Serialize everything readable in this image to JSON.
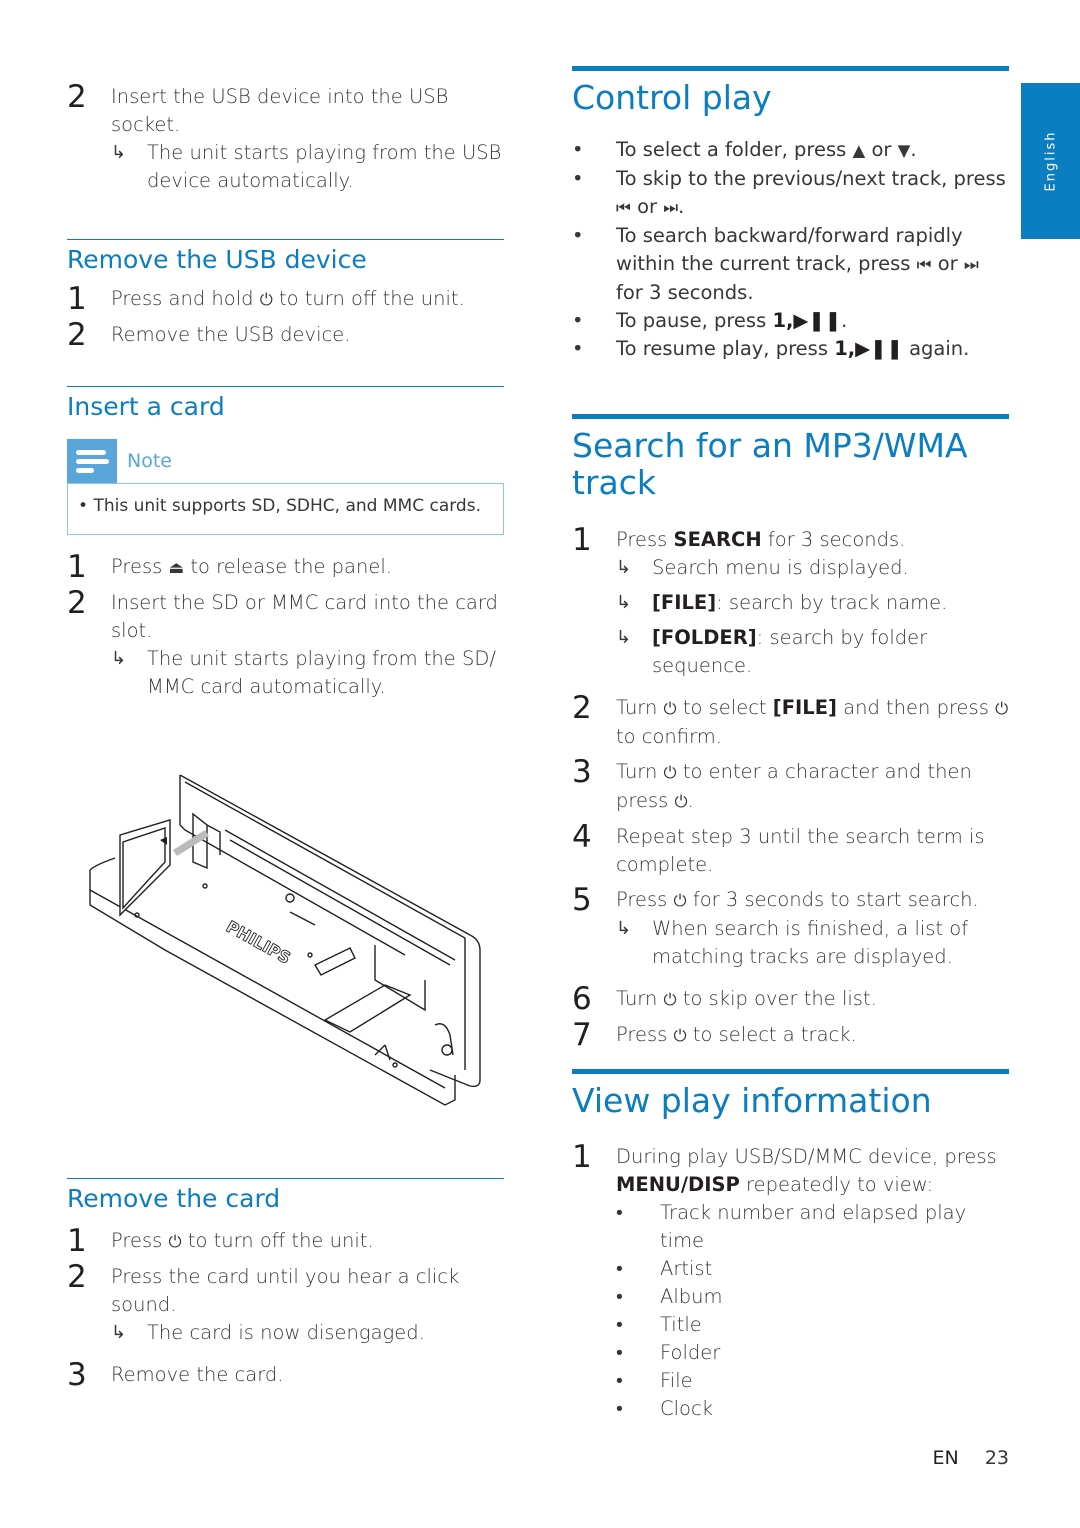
{
  "side_tab": {
    "label": "English",
    "color": "#0b7dc1"
  },
  "accent_color": "#0b7dc1",
  "left": {
    "insert_usb": {
      "step2_num": "2",
      "step2_text": "Insert the USB device into the USB socket.",
      "step2_result": "The unit starts playing from the USB device automatically."
    },
    "remove_usb": {
      "title": "Remove the USB device",
      "steps": [
        {
          "num": "1",
          "pre": "Press and hold",
          "icon": "power-icon",
          "post": "to turn off the unit."
        },
        {
          "num": "2",
          "text": "Remove the USB device."
        }
      ]
    },
    "insert_card": {
      "title": "Insert a card",
      "note_label": "Note",
      "note_text": "This unit supports SD, SDHC, and MMC cards.",
      "steps": [
        {
          "num": "1",
          "pre": "Press",
          "icon": "eject-icon",
          "post": "to release the panel."
        },
        {
          "num": "2",
          "text": "Insert the SD or MMC card into the card slot.",
          "result": "The unit starts playing from the SD/ MMC card automatically."
        }
      ],
      "illustration_brand": "PHILIPS"
    },
    "remove_card": {
      "title": "Remove the card",
      "steps": [
        {
          "num": "1",
          "pre": "Press",
          "icon": "power-icon",
          "post": "to turn off the unit."
        },
        {
          "num": "2",
          "text": "Press the card until you hear a click sound.",
          "result": "The card is now disengaged."
        },
        {
          "num": "3",
          "text": "Remove the card."
        }
      ]
    }
  },
  "right": {
    "control_play": {
      "title": "Control play",
      "bullets": [
        {
          "pre": "To select a folder, press",
          "icon1": "▲",
          "mid": "or",
          "icon2": "▼",
          "post": "."
        },
        {
          "pre": "To skip to the previous/next track, press",
          "icon1": "⏮",
          "mid": "or",
          "icon2": "⏭",
          "post": "."
        },
        {
          "pre": "To search backward/forward rapidly within the current track, press",
          "icon1": "⏮",
          "mid": "or",
          "icon2": "⏭",
          "post": "for 3 seconds."
        },
        {
          "pre": "To pause, press",
          "key": "1,▶❚❚",
          "post": "."
        },
        {
          "pre": "To resume play, press",
          "key": "1,▶❚❚",
          "post": "again."
        }
      ]
    },
    "search": {
      "title": "Search for an MP3/WMA track",
      "step1": {
        "num": "1",
        "pre": "Press",
        "key": "SEARCH",
        "post": "for 3 seconds.",
        "results": [
          {
            "text": "Search menu is displayed."
          },
          {
            "key": "[FILE]",
            "text": ": search by track name."
          },
          {
            "key": "[FOLDER]",
            "text": ": search by folder sequence."
          }
        ]
      },
      "step2": {
        "num": "2",
        "pre": "Turn",
        "mid": "to select",
        "key": "[FILE]",
        "post": "and then press",
        "post2": "to confirm."
      },
      "step3": {
        "num": "3",
        "pre": "Turn",
        "mid": "to enter a character and then press",
        "post": "."
      },
      "step4": {
        "num": "4",
        "text": "Repeat step 3 until the search term is complete."
      },
      "step5": {
        "num": "5",
        "pre": "Press",
        "post": "for 3 seconds to start search.",
        "result": "When search is finished, a list of matching tracks are displayed."
      },
      "step6": {
        "num": "6",
        "pre": "Turn",
        "post": "to skip over the list."
      },
      "step7": {
        "num": "7",
        "pre": "Press",
        "post": "to select a track."
      }
    },
    "view_info": {
      "title": "View play information",
      "step1": {
        "num": "1",
        "pre": "During play USB/SD/MMC device, press",
        "key": "MENU/DISP",
        "post": "repeatedly to view:"
      },
      "items": [
        "Track number and elapsed play time",
        "Artist",
        "Album",
        "Title",
        "Folder",
        "File",
        "Clock"
      ]
    }
  },
  "footer": {
    "lang": "EN",
    "page": "23"
  },
  "glyphs": {
    "power": "⏻",
    "eject": "⏏",
    "arrow": "↳",
    "bullet": "•"
  }
}
